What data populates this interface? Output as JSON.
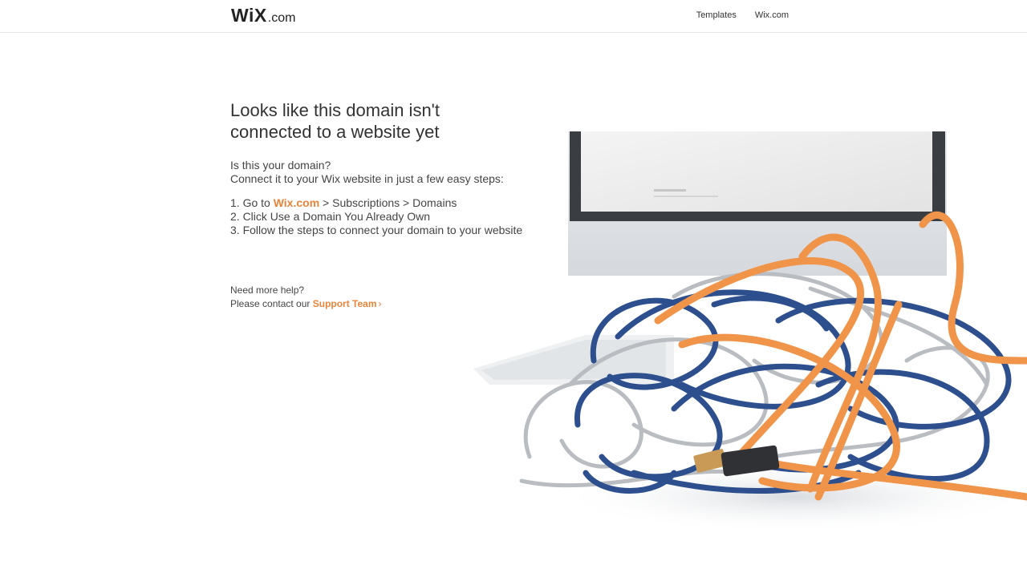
{
  "header": {
    "logo": {
      "main": "WiX",
      "suffix": ".com"
    },
    "nav": [
      {
        "label": "Templates"
      },
      {
        "label": "Wix.com"
      }
    ]
  },
  "main": {
    "headline_line1": "Looks like this domain isn't",
    "headline_line2": "connected to a website yet",
    "intro_line1": "Is this your domain?",
    "intro_line2": "Connect it to your Wix website in just a few easy steps:",
    "steps": [
      {
        "prefix": "1. Go to ",
        "link": "Wix.com",
        "suffix": " > Subscriptions > Domains"
      },
      {
        "text": "2. Click Use a Domain You Already Own"
      },
      {
        "text": "3. Follow the steps to connect your domain to your website"
      }
    ],
    "help_line1": "Need more help?",
    "help_prefix": "Please contact our ",
    "help_link": "Support Team",
    "help_chevron": "›"
  },
  "colors": {
    "accent": "#e8843a",
    "text": "#333333",
    "cable_blue": "#2d4f8e",
    "cable_orange": "#f0944a"
  },
  "illustration": {
    "name": "tangled-cables-and-monitor-image"
  }
}
